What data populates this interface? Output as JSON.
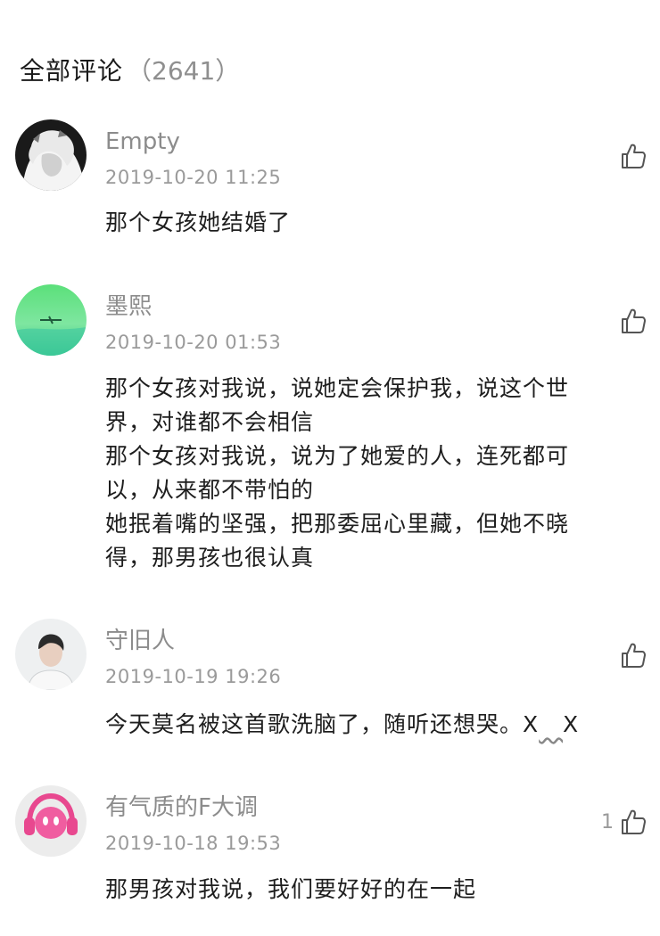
{
  "header": {
    "title": "全部评论",
    "count": "（2641）"
  },
  "comments": [
    {
      "username": "Empty",
      "time": "2019-10-20 11:25",
      "lines": [
        "那个女孩她结婚了"
      ],
      "likes": "",
      "avatar": "avatar-empty"
    },
    {
      "username": "墨熙",
      "time": "2019-10-20 01:53",
      "lines": [
        "那个女孩对我说，说她定会保护我，说这个世",
        "界，对谁都不会相信",
        "那个女孩对我说，说为了她爱的人，连死都可",
        "以，从来都不带怕的",
        "她抿着嘴的坚强，把那委屈心里藏，但她不晓",
        "得，那男孩也很认真"
      ],
      "likes": "",
      "avatar": "avatar-green"
    },
    {
      "username": "守旧人",
      "time": "2019-10-19 19:26",
      "lines": [
        "今天莫名被这首歌洗脑了，随听还想哭。X"
      ],
      "tail_mid": "   ",
      "tail_end": "X",
      "likes": "",
      "avatar": "avatar-man"
    },
    {
      "username": "有气质的F大调",
      "time": "2019-10-18 19:53",
      "lines": [
        "那男孩对我说，我们要好好的在一起"
      ],
      "likes": "1",
      "avatar": "avatar-headphones"
    }
  ],
  "colors": {
    "username": "#8c8c8c",
    "timestamp": "#9a9a9a",
    "text": "#1e1e1e",
    "icon": "#555555"
  },
  "icons": {
    "like": "thumbs-up-icon"
  }
}
